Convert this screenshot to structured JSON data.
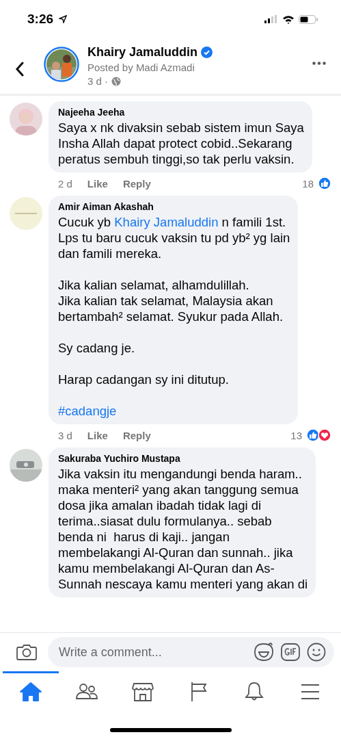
{
  "status_bar": {
    "time": "3:26"
  },
  "post_header": {
    "author": "Khairy Jamaluddin",
    "verified": true,
    "posted_by": "Posted by Madi Azmadi",
    "time": "3 d ·"
  },
  "comments": [
    {
      "author": "Najeeha Jeeha",
      "avatar": {
        "kind": "picture"
      },
      "paragraphs": [
        {
          "lines": [
            [
              {
                "text": "Saya x nk divaksin sebab sistem imun Saya"
              }
            ],
            [
              {
                "text": "Insha Allah dapat protect cobid..Sekarang"
              }
            ],
            [
              {
                "text": "peratus sembuh tinggi,so tak perlu vaksin."
              }
            ]
          ]
        }
      ],
      "time": "2 d",
      "like": "Like",
      "reply": "Reply",
      "reaction_count": "18",
      "reactions": [
        {
          "kind": "like"
        }
      ]
    },
    {
      "author": "Amir Aiman Akashah",
      "avatar": {
        "kind": "picture"
      },
      "paragraphs": [
        {
          "lines": [
            [
              {
                "text": "Cucuk yb "
              },
              {
                "text": "Khairy Jamaluddin",
                "kind": "mention"
              },
              {
                "text": " n famili 1st."
              }
            ],
            [
              {
                "text": "Lps tu baru cucuk vaksin tu pd yb² yg lain"
              }
            ],
            [
              {
                "text": "dan famili mereka."
              }
            ]
          ]
        },
        {
          "lines": [
            [
              {
                "text": "Jika kalian selamat, alhamdulillah."
              }
            ],
            [
              {
                "text": "Jika kalian tak selamat, Malaysia akan"
              }
            ],
            [
              {
                "text": "bertambah² selamat. Syukur pada Allah."
              }
            ]
          ]
        },
        {
          "lines": [
            [
              {
                "text": "Sy cadang je."
              }
            ]
          ]
        },
        {
          "lines": [
            [
              {
                "text": "Harap cadangan sy ini ditutup."
              }
            ]
          ]
        },
        {
          "lines": [
            [
              {
                "text": "#cadangje",
                "kind": "hashtag"
              }
            ]
          ]
        }
      ],
      "time": "3 d",
      "like": "Like",
      "reply": "Reply",
      "reaction_count": "13",
      "reactions": [
        {
          "kind": "like"
        },
        {
          "kind": "love"
        }
      ]
    },
    {
      "author": "Sakuraba Yuchiro Mustapa",
      "avatar": {
        "kind": "picture"
      },
      "paragraphs": [
        {
          "lines": [
            [
              {
                "text": "Jika vaksin itu mengandungi benda haram.."
              }
            ],
            [
              {
                "text": "maka menteri² yang akan tanggung semua"
              }
            ],
            [
              {
                "text": "dosa jika amalan ibadah tidak lagi di"
              }
            ],
            [
              {
                "text": "terima..siasat dulu formulanya.. sebab"
              }
            ],
            [
              {
                "text": "benda ni  harus di kaji.. jangan"
              }
            ],
            [
              {
                "text": "membelakangi Al-Quran dan sunnah.. jika"
              }
            ],
            [
              {
                "text": "kamu membelakangi Al-Quran dan As-"
              }
            ],
            [
              {
                "text": "Sunnah nescaya kamu menteri yang akan di"
              }
            ]
          ]
        }
      ]
    }
  ],
  "comment_bar": {
    "placeholder": "Write a comment..."
  },
  "tabs": [
    {
      "kind": "home",
      "selected": true
    },
    {
      "kind": "friends",
      "selected": false
    },
    {
      "kind": "marketplace",
      "selected": false
    },
    {
      "kind": "pages",
      "selected": false
    },
    {
      "kind": "notifications",
      "selected": false
    },
    {
      "kind": "menu",
      "selected": false
    }
  ]
}
